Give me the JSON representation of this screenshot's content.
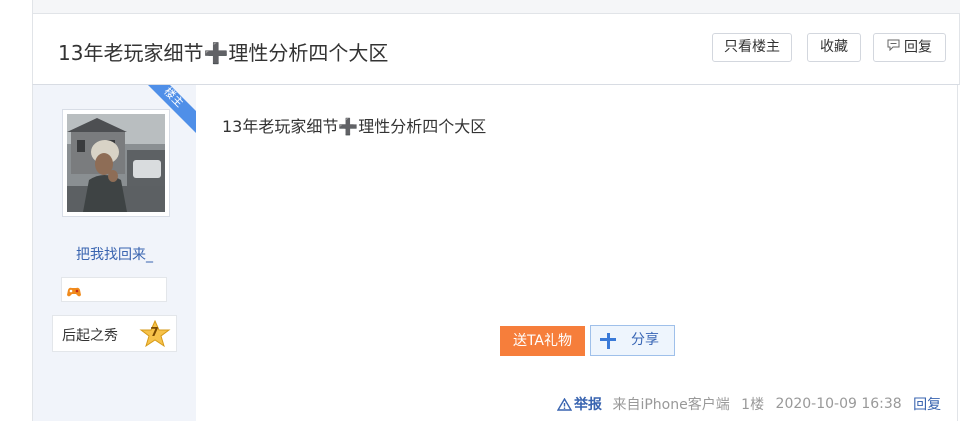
{
  "header": {
    "title": "13年老玩家细节➕理性分析四个大区",
    "buttons": {
      "only_op": "只看楼主",
      "favorite": "收藏",
      "reply": "回复"
    }
  },
  "author": {
    "op_tag": "楼主",
    "username": "把我找回来_",
    "level_title": "后起之秀",
    "level": "7"
  },
  "post": {
    "content": "13年老玩家细节➕理性分析四个大区",
    "gift_button": "送TA礼物",
    "share_button": "分享",
    "footer": {
      "report": "举报",
      "source": "来自iPhone客户端",
      "floor": "1楼",
      "time": "2020-10-09 16:38",
      "reply": "回复"
    }
  },
  "colors": {
    "link_blue": "#3964b0",
    "gift_orange": "#f67e3b",
    "op_ribbon": "#4f8fe8",
    "sidebar_bg": "#f1f4fa"
  }
}
